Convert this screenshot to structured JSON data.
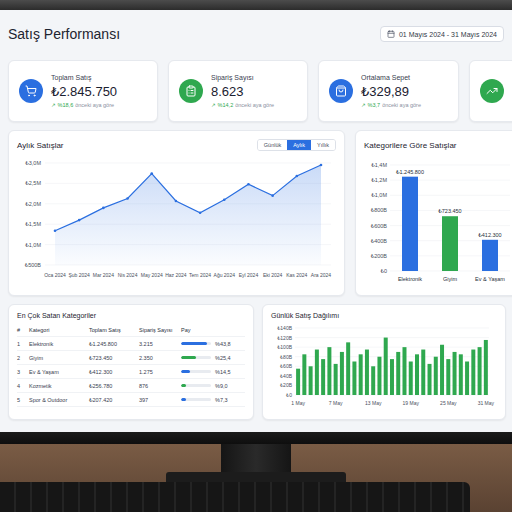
{
  "header": {
    "title": "Satış Performansı",
    "date_range": "01 Mayıs 2024 - 31 Mayıs 2024"
  },
  "kpis": [
    {
      "label": "Toplam Satış",
      "value": "₺2.845.750",
      "arrow": "↗",
      "delta": "%18,6",
      "note": "önceki aya göre",
      "color": "#2b6fe0"
    },
    {
      "label": "Sipariş Sayısı",
      "value": "8.623",
      "arrow": "↗",
      "delta": "%14,2",
      "note": "önceki aya göre",
      "color": "#2fa84f"
    },
    {
      "label": "Ortalama Sepet",
      "value": "₺329,89",
      "arrow": "↗",
      "delta": "%3,7",
      "note": "önceki aya göre",
      "color": "#2b6fe0"
    }
  ],
  "partial_card": {
    "color": "#2fa84f"
  },
  "monthly_chart": {
    "title": "Aylık Satışlar",
    "periods": [
      {
        "label": "Günlük",
        "selected": false
      },
      {
        "label": "Aylık",
        "selected": true
      },
      {
        "label": "Yıllık",
        "selected": false
      }
    ],
    "y_ticks": [
      "₺3,0M",
      "₺2,5M",
      "₺2,0M",
      "₺1,5M",
      "₺1,0M",
      "₺500B"
    ],
    "x_labels": [
      "Oca 2024",
      "Şub 2024",
      "Mar 2024",
      "Nis 2024",
      "May 2024",
      "Haz 2024",
      "Tem 2024",
      "Ağu 2024",
      "Eyl 2024",
      "Eki 2024",
      "Kas 2024",
      "Ara 2024"
    ],
    "values": [
      1340000,
      1600000,
      1900000,
      2130000,
      2740000,
      2070000,
      1780000,
      2100000,
      2480000,
      2200000,
      2680000,
      2950000
    ]
  },
  "category_chart": {
    "title": "Kategorilere Göre Satışlar",
    "y_ticks": [
      "₺1,4M",
      "₺1,2M",
      "₺1,0M",
      "₺800B",
      "₺600B",
      "₺400B",
      "₺200B",
      "₺0"
    ],
    "bars": [
      {
        "label": "Elektronik",
        "value": 1245800,
        "value_label": "₺1.245.800",
        "color": "#2b6fe0"
      },
      {
        "label": "Giyim",
        "value": 723450,
        "value_label": "₺723.450",
        "color": "#2fa84f"
      },
      {
        "label": "Ev & Yaşam",
        "value": 412300,
        "value_label": "₺412.300",
        "color": "#2b6fe0"
      }
    ]
  },
  "top_categories": {
    "title": "En Çok Satan Kategoriler",
    "columns": [
      "#",
      "Kategori",
      "Toplam Satış",
      "Sipariş Sayısı",
      "Pay"
    ],
    "rows": [
      {
        "rank": "1",
        "name": "Elektronik",
        "sales": "₺1.245.800",
        "orders": "3.215",
        "share": "%43,8",
        "level": 0.88,
        "color": "#2b6fe0"
      },
      {
        "rank": "2",
        "name": "Giyim",
        "sales": "₺723.450",
        "orders": "2.350",
        "share": "%25,4",
        "level": 0.51,
        "color": "#2fa84f"
      },
      {
        "rank": "3",
        "name": "Ev & Yaşam",
        "sales": "₺412.300",
        "orders": "1.275",
        "share": "%14,5",
        "level": 0.29,
        "color": "#2b6fe0"
      },
      {
        "rank": "4",
        "name": "Kozmetik",
        "sales": "₺256.780",
        "orders": "876",
        "share": "%9,0",
        "level": 0.18,
        "color": "#2fa84f"
      },
      {
        "rank": "5",
        "name": "Spor & Outdoor",
        "sales": "₺207.420",
        "orders": "397",
        "share": "%7,3",
        "level": 0.15,
        "color": "#2b6fe0"
      }
    ]
  },
  "daily_chart": {
    "title": "Günlük Satış Dağılımı",
    "y_ticks": [
      "₺140B",
      "₺120B",
      "₺100B",
      "₺80B",
      "₺60B",
      "₺40B",
      "₺20B",
      "₺0"
    ],
    "x_labels": [
      "1 May",
      "7 May",
      "13 May",
      "19 May",
      "25 May",
      "31 May"
    ],
    "values": [
      55000,
      85000,
      60000,
      95000,
      75000,
      100000,
      65000,
      90000,
      110000,
      70000,
      85000,
      95000,
      60000,
      80000,
      120000,
      75000,
      90000,
      100000,
      70000,
      85000,
      95000,
      65000,
      80000,
      105000,
      75000,
      90000,
      85000,
      70000,
      95000,
      100000,
      115000
    ]
  }
}
